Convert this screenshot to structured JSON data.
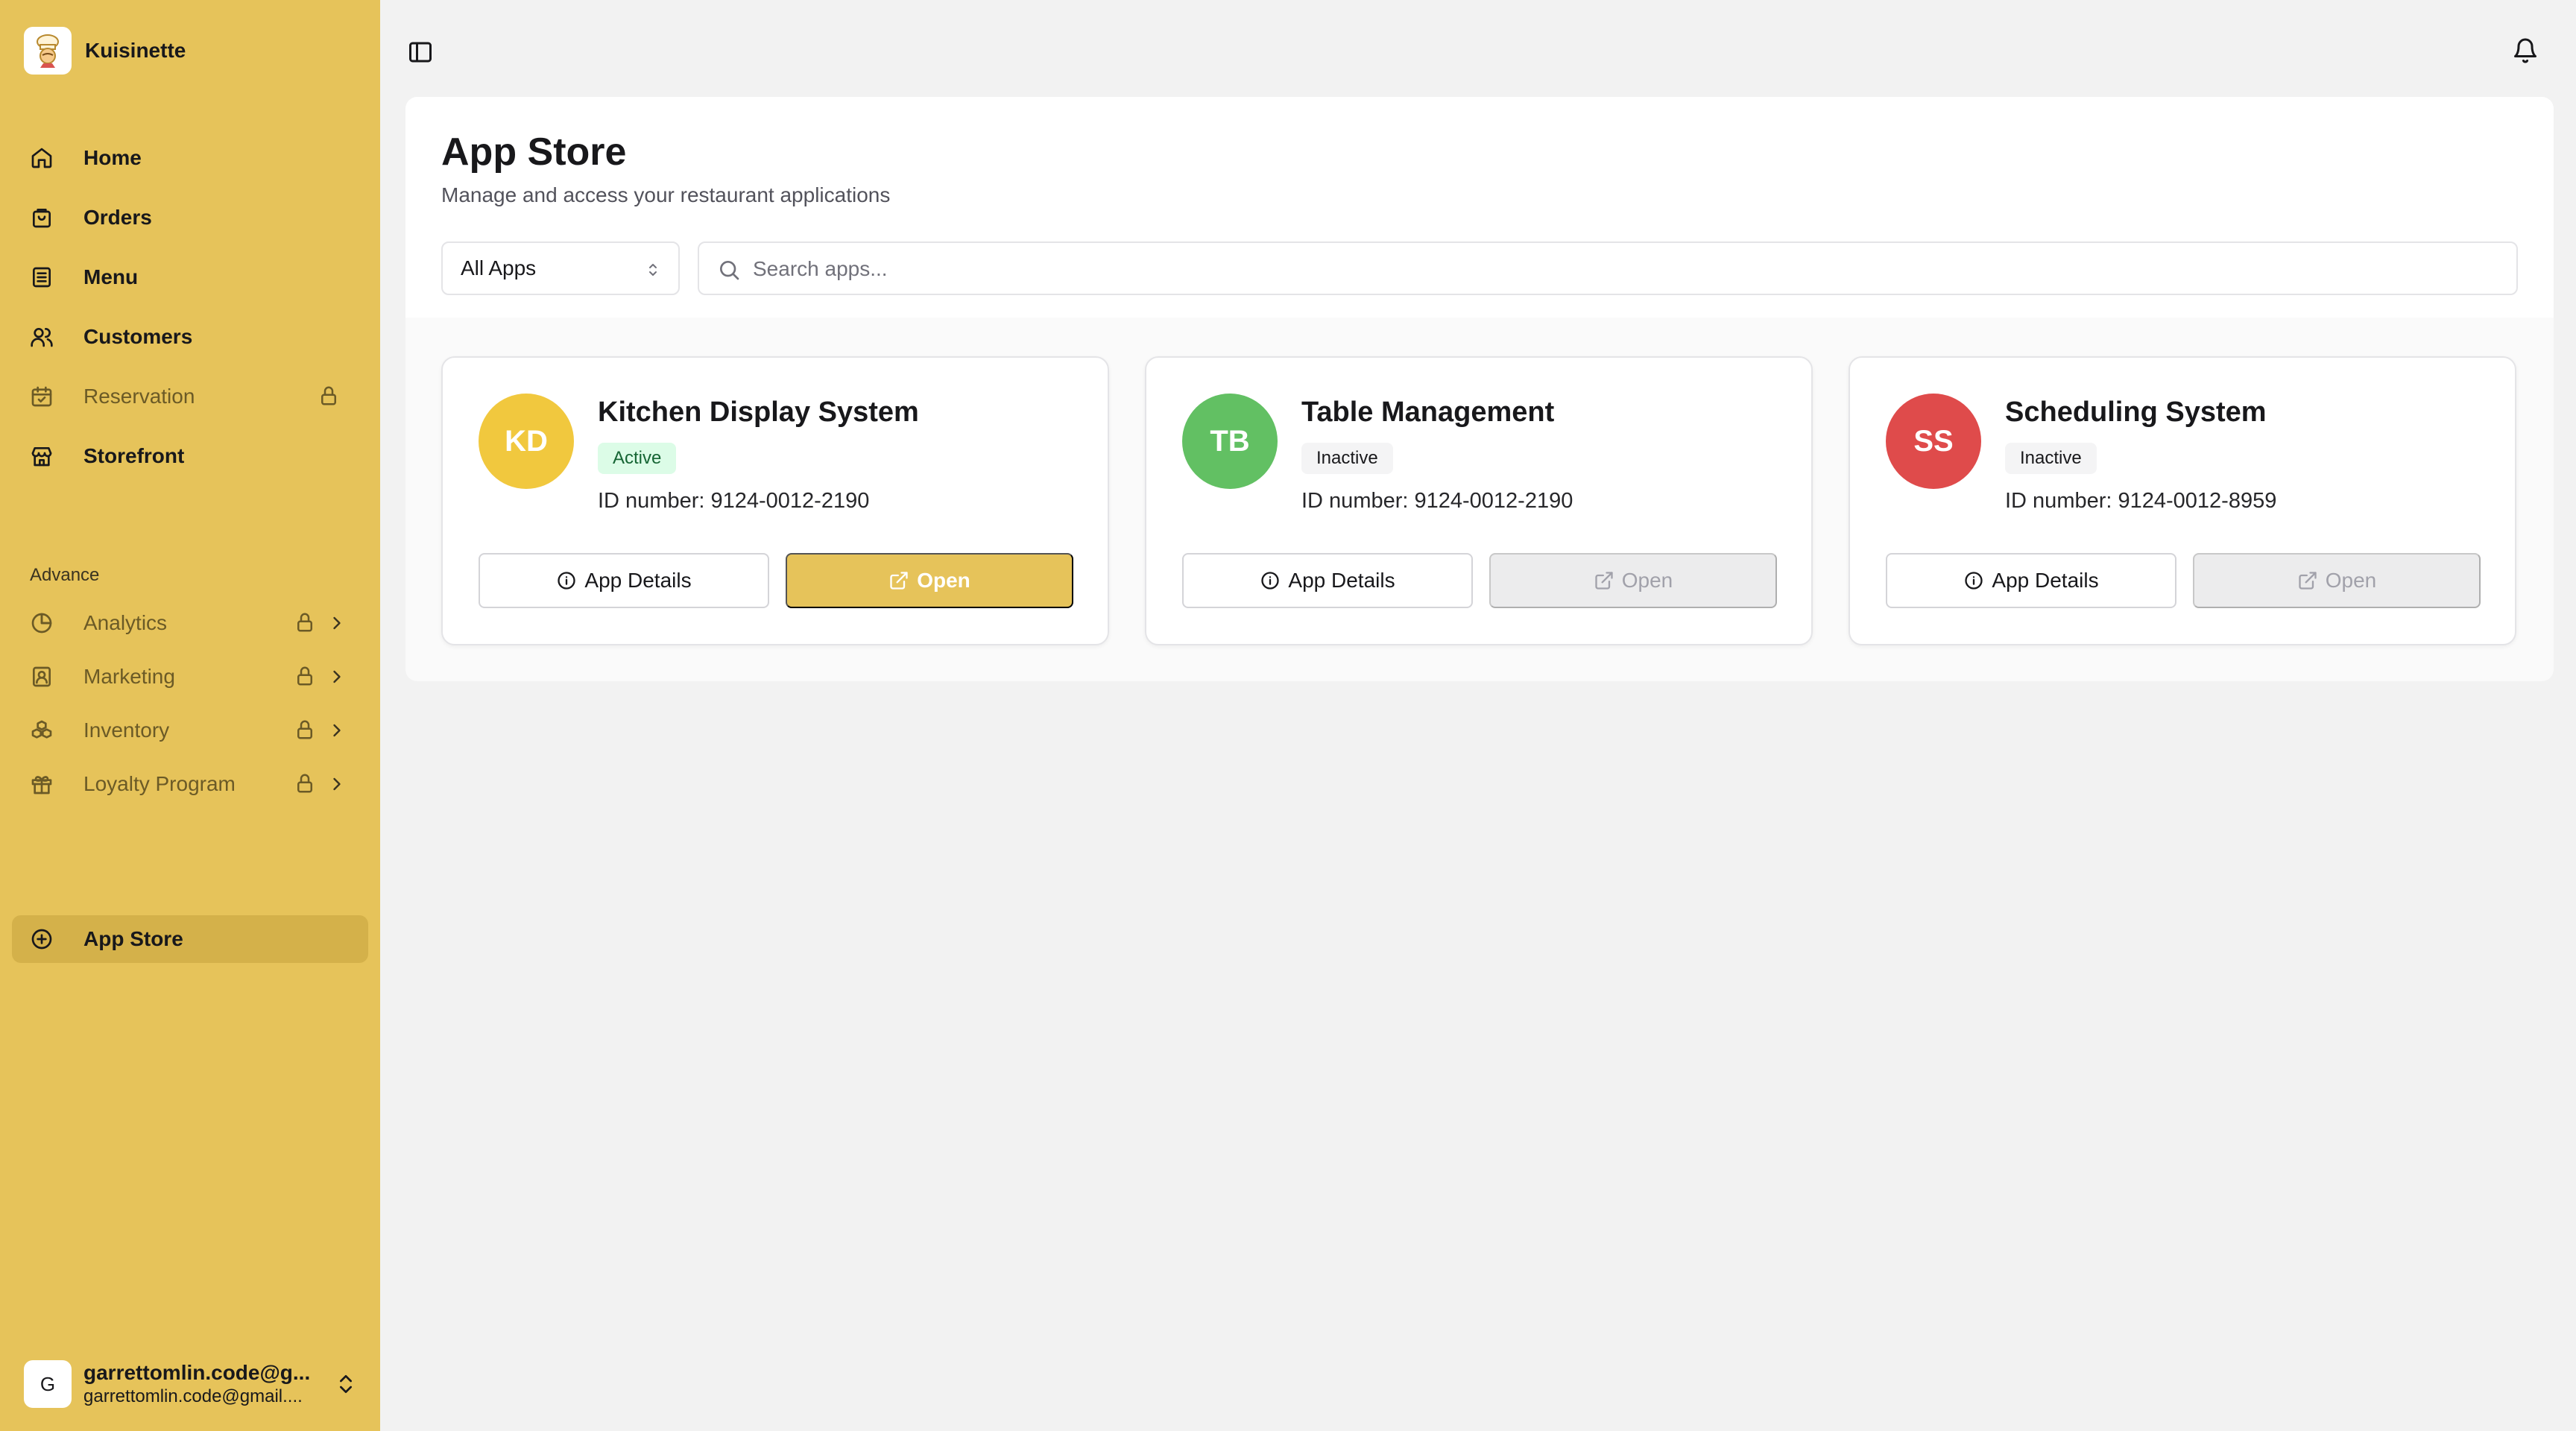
{
  "brand": {
    "name": "Kuisinette",
    "logo_icon": "chef-icon"
  },
  "nav": {
    "main": [
      {
        "label": "Home",
        "icon": "home-icon",
        "locked": false
      },
      {
        "label": "Orders",
        "icon": "bag-icon",
        "locked": false
      },
      {
        "label": "Menu",
        "icon": "list-icon",
        "locked": false
      },
      {
        "label": "Customers",
        "icon": "users-icon",
        "locked": false
      },
      {
        "label": "Reservation",
        "icon": "calendar-check-icon",
        "locked": true
      },
      {
        "label": "Storefront",
        "icon": "store-icon",
        "locked": false
      }
    ],
    "section_label": "Advance",
    "advance": [
      {
        "label": "Analytics",
        "icon": "pie-chart-icon",
        "locked": true
      },
      {
        "label": "Marketing",
        "icon": "contact-icon",
        "locked": true
      },
      {
        "label": "Inventory",
        "icon": "boxes-icon",
        "locked": true
      },
      {
        "label": "Loyalty Program",
        "icon": "gift-icon",
        "locked": true
      }
    ],
    "app_store": {
      "label": "App Store",
      "icon": "plus-circle-icon",
      "active": true
    }
  },
  "user": {
    "initial": "G",
    "name": "garrettomlin.code@g...",
    "email": "garrettomlin.code@gmail...."
  },
  "page": {
    "title": "App Store",
    "subtitle": "Manage and access your restaurant applications",
    "filter": {
      "selected": "All Apps"
    },
    "search": {
      "placeholder": "Search apps...",
      "value": ""
    }
  },
  "apps": [
    {
      "initials": "KD",
      "name": "Kitchen Display System",
      "status": "Active",
      "id_text": "ID number: 9124-0012-2190",
      "color": "#f1c83e",
      "details_label": "App Details",
      "open_label": "Open",
      "open_enabled": true
    },
    {
      "initials": "TB",
      "name": "Table Management",
      "status": "Inactive",
      "id_text": "ID number: 9124-0012-2190",
      "color": "#62c063",
      "details_label": "App Details",
      "open_label": "Open",
      "open_enabled": false
    },
    {
      "initials": "SS",
      "name": "Scheduling System",
      "status": "Inactive",
      "id_text": "ID number: 9124-0012-8959",
      "color": "#df4b4b",
      "details_label": "App Details",
      "open_label": "Open",
      "open_enabled": false
    }
  ],
  "colors": {
    "sidebar_bg": "#e6c35a",
    "sidebar_active": "#d4b14a",
    "accent": "#e6c35a",
    "active_badge_bg": "#dcfce7",
    "active_badge_text": "#166534"
  }
}
